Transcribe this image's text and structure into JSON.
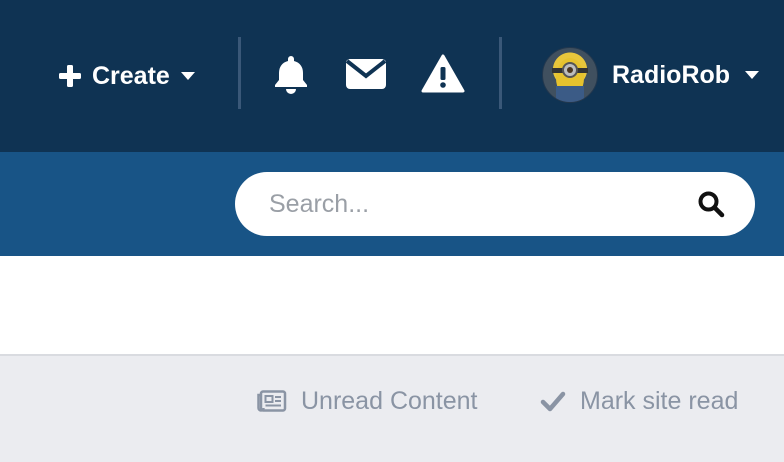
{
  "header": {
    "create_label": "Create",
    "icons": [
      "plus-icon",
      "bell-icon",
      "envelope-icon",
      "warning-icon"
    ],
    "username": "RadioRob",
    "colors": {
      "topbar": "#0f3353",
      "searchband": "#185486"
    }
  },
  "search": {
    "placeholder": "Search..."
  },
  "actions": {
    "unread_label": "Unread Content",
    "mark_read_label": "Mark site read"
  }
}
